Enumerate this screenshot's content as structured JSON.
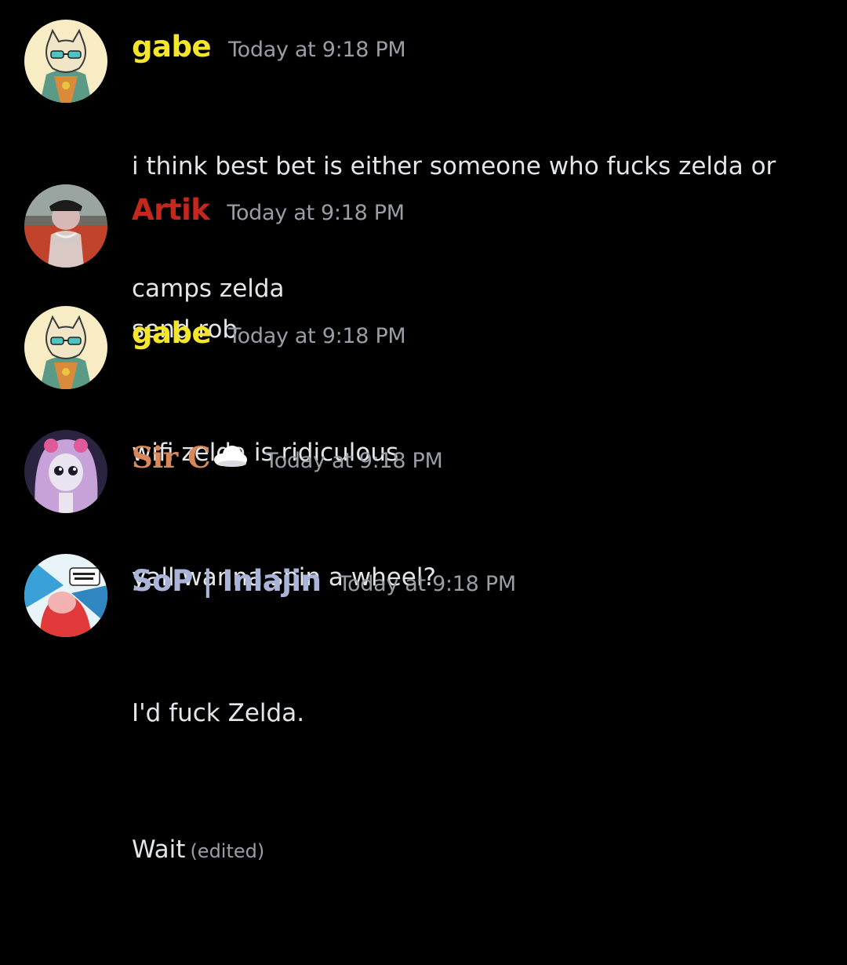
{
  "colors": {
    "background": "#000000",
    "gabe": "#f5e62c",
    "artik": "#c4281c",
    "sirc": "#d8875a",
    "sop": "#a9b4d8",
    "timestamp": "#9a9da6",
    "text": "#e3e5e8"
  },
  "messages": [
    {
      "username": "gabe",
      "timestamp": "Today at 9:18 PM",
      "lines": [
        "i think best bet is either someone who fucks zelda or",
        "camps zelda"
      ],
      "avatar_icon": "cat-avatar-icon"
    },
    {
      "username": "Artik",
      "timestamp": "Today at 9:18 PM",
      "lines": [
        "send rob"
      ],
      "avatar_icon": "rat-avatar-icon"
    },
    {
      "username": "gabe",
      "timestamp": "Today at 9:18 PM",
      "lines": [
        "wifi zelda is ridiculous"
      ],
      "avatar_icon": "cat-avatar-icon"
    },
    {
      "username": "Sir C",
      "username_emoji": "cloud-icon",
      "timestamp": "Today at 9:18 PM",
      "lines": [
        "yall wanna spin a wheel?"
      ],
      "avatar_icon": "anime-girl-avatar-icon"
    },
    {
      "username": "SoP | Inlajin",
      "timestamp": "Today at 9:18 PM",
      "lines": [
        "I'd fuck Zelda.",
        "Wait"
      ],
      "edited_label": "(edited)",
      "avatar_icon": "comic-art-avatar-icon"
    }
  ]
}
